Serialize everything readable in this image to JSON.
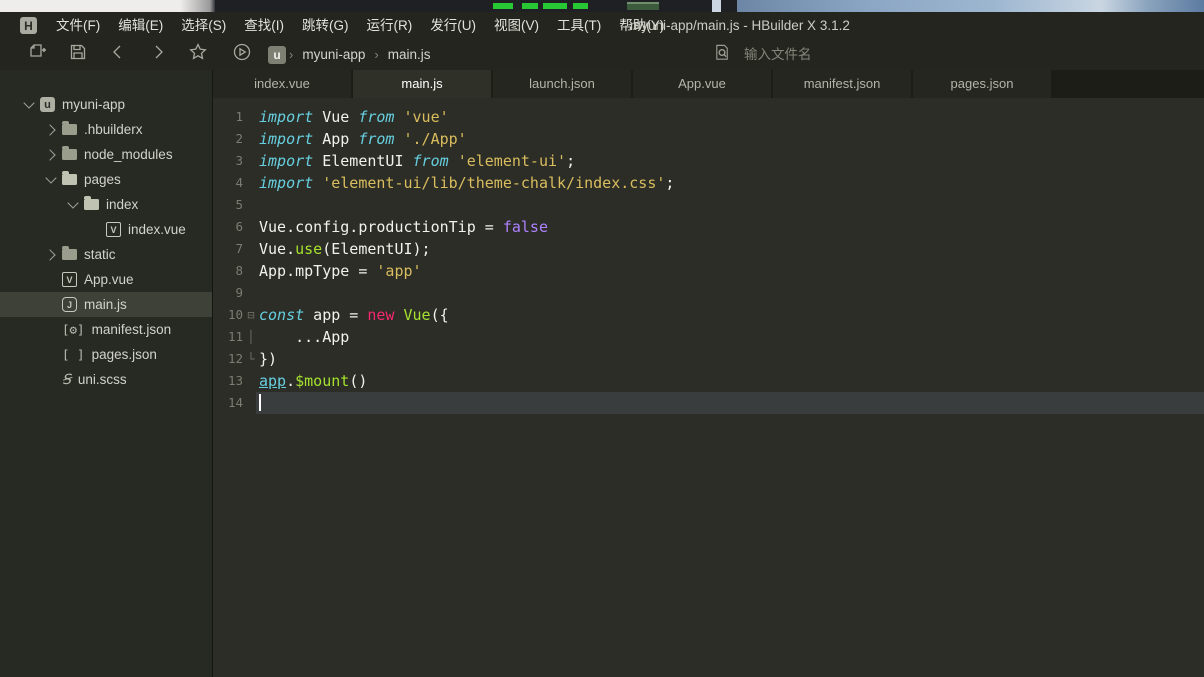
{
  "colors": {
    "chrome_bg": "#23251e",
    "sidebar_bg": "#272923",
    "sidebar_selected": "#3e4138",
    "editor_bg": "#2b2d26",
    "current_line": "#3a3d3e",
    "syn_keyword": "#67cfe0",
    "syn_plain": "#f2f2ec",
    "syn_string": "#d9bd5e",
    "syn_constant": "#ae81ff",
    "syn_function": "#a6e22e",
    "syn_operator": "#f92672"
  },
  "window": {
    "logo": "H",
    "title": "myuni-app/main.js - HBuilder X 3.1.2"
  },
  "menu": {
    "items": [
      "文件(F)",
      "编辑(E)",
      "选择(S)",
      "查找(I)",
      "跳转(G)",
      "运行(R)",
      "发行(U)",
      "视图(V)",
      "工具(T)",
      "帮助(Y)"
    ]
  },
  "toolbar": {
    "breadcrumb": {
      "project_icon": "u",
      "project": "myuni-app",
      "separator": "›",
      "file": "main.js"
    },
    "search_placeholder": "输入文件名"
  },
  "tabs": [
    {
      "label": "index.vue",
      "active": false
    },
    {
      "label": "main.js",
      "active": true
    },
    {
      "label": "launch.json",
      "active": false
    },
    {
      "label": "App.vue",
      "active": false
    },
    {
      "label": "manifest.json",
      "active": false
    },
    {
      "label": "pages.json",
      "active": false
    }
  ],
  "sidebar": {
    "items": [
      {
        "label": "myuni-app",
        "indent": 0,
        "arrow": "open",
        "icon": "project",
        "selected": false
      },
      {
        "label": ".hbuilderx",
        "indent": 1,
        "arrow": "closed",
        "icon": "folder",
        "selected": false
      },
      {
        "label": "node_modules",
        "indent": 1,
        "arrow": "closed",
        "icon": "folder",
        "selected": false
      },
      {
        "label": "pages",
        "indent": 1,
        "arrow": "open",
        "icon": "folder-open",
        "selected": false
      },
      {
        "label": "index",
        "indent": 2,
        "arrow": "open",
        "icon": "folder-open",
        "selected": false
      },
      {
        "label": "index.vue",
        "indent": 3,
        "arrow": null,
        "icon": "vue",
        "selected": false
      },
      {
        "label": "static",
        "indent": 1,
        "arrow": "closed",
        "icon": "folder",
        "selected": false
      },
      {
        "label": "App.vue",
        "indent": 1,
        "arrow": null,
        "icon": "vue",
        "selected": false
      },
      {
        "label": "main.js",
        "indent": 1,
        "arrow": null,
        "icon": "js",
        "selected": true
      },
      {
        "label": "manifest.json",
        "indent": 1,
        "arrow": null,
        "icon": "json-gear",
        "selected": false
      },
      {
        "label": "pages.json",
        "indent": 1,
        "arrow": null,
        "icon": "json-brackets",
        "selected": false
      },
      {
        "label": "uni.scss",
        "indent": 1,
        "arrow": null,
        "icon": "scss",
        "selected": false
      }
    ]
  },
  "editor": {
    "icon_glyphs": {
      "project": "u",
      "vue": "V",
      "js": "J",
      "json-gear": "[⚙]",
      "json-brackets": "[ ]",
      "scss": "Ꞩ"
    },
    "fold_glyphs": {
      "start": "⊟",
      "mid": "│",
      "end": "└"
    },
    "cursor_line": 14,
    "current_line": 14,
    "lines": [
      {
        "num": 1,
        "fold": null,
        "tokens": [
          [
            "import",
            "k"
          ],
          [
            " Vue ",
            "i"
          ],
          [
            "from",
            "k"
          ],
          [
            " ",
            "i"
          ],
          [
            "'vue'",
            "s"
          ]
        ]
      },
      {
        "num": 2,
        "fold": null,
        "tokens": [
          [
            "import",
            "k"
          ],
          [
            " App ",
            "i"
          ],
          [
            "from",
            "k"
          ],
          [
            " ",
            "i"
          ],
          [
            "'./App'",
            "s"
          ]
        ]
      },
      {
        "num": 3,
        "fold": null,
        "tokens": [
          [
            "import",
            "k"
          ],
          [
            " ElementUI ",
            "i"
          ],
          [
            "from",
            "k"
          ],
          [
            " ",
            "i"
          ],
          [
            "'element-ui'",
            "s"
          ],
          [
            ";",
            "i"
          ]
        ]
      },
      {
        "num": 4,
        "fold": null,
        "tokens": [
          [
            "import",
            "k"
          ],
          [
            " ",
            "i"
          ],
          [
            "'element-ui/lib/theme-chalk/index.css'",
            "s"
          ],
          [
            ";",
            "i"
          ]
        ]
      },
      {
        "num": 5,
        "fold": null,
        "tokens": []
      },
      {
        "num": 6,
        "fold": null,
        "tokens": [
          [
            "Vue.config.productionTip = ",
            "i"
          ],
          [
            "false",
            "p"
          ]
        ]
      },
      {
        "num": 7,
        "fold": null,
        "tokens": [
          [
            "Vue.",
            "i"
          ],
          [
            "use",
            "g"
          ],
          [
            "(ElementUI);",
            "i"
          ]
        ]
      },
      {
        "num": 8,
        "fold": null,
        "tokens": [
          [
            "App.mpType = ",
            "i"
          ],
          [
            "'app'",
            "s"
          ]
        ]
      },
      {
        "num": 9,
        "fold": null,
        "tokens": []
      },
      {
        "num": 10,
        "fold": "start",
        "tokens": [
          [
            "const",
            "k"
          ],
          [
            " app = ",
            "i"
          ],
          [
            "new",
            "r"
          ],
          [
            " ",
            "i"
          ],
          [
            "Vue",
            "g"
          ],
          [
            "({",
            "i"
          ]
        ]
      },
      {
        "num": 11,
        "fold": "mid",
        "tokens": [
          [
            "    ...App",
            "i"
          ]
        ]
      },
      {
        "num": 12,
        "fold": "end",
        "tokens": [
          [
            "})",
            "i"
          ]
        ]
      },
      {
        "num": 13,
        "fold": null,
        "tokens": [
          [
            "app",
            "u"
          ],
          [
            ".",
            "i"
          ],
          [
            "$mount",
            "g"
          ],
          [
            "()",
            "i"
          ]
        ]
      },
      {
        "num": 14,
        "fold": null,
        "tokens": []
      }
    ]
  }
}
